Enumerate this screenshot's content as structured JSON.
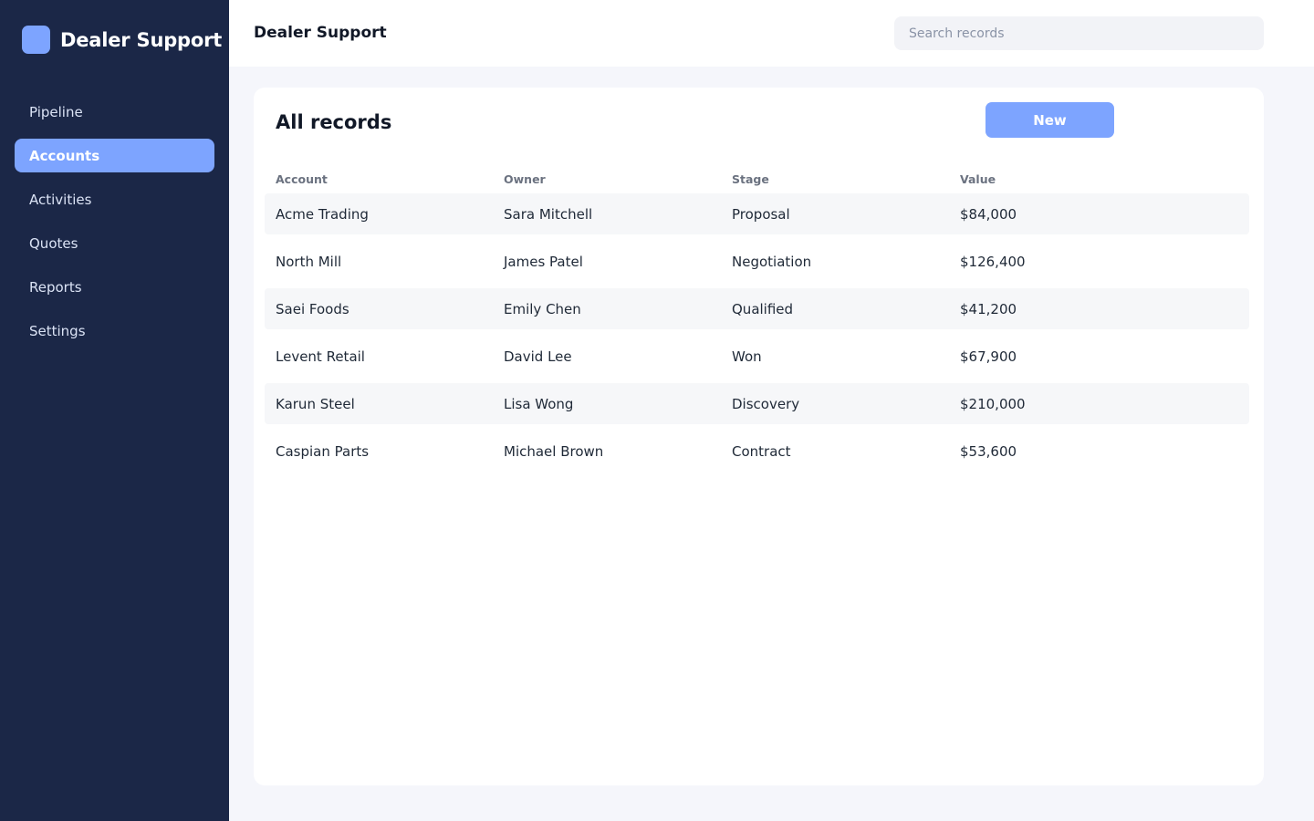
{
  "app": {
    "name": "Dealer Support"
  },
  "sidebar": {
    "items": [
      {
        "label": "Pipeline"
      },
      {
        "label": "Accounts",
        "active": true
      },
      {
        "label": "Activities"
      },
      {
        "label": "Quotes"
      },
      {
        "label": "Reports"
      },
      {
        "label": "Settings"
      }
    ]
  },
  "header": {
    "title": "Dealer Support",
    "search_placeholder": "Search records"
  },
  "main": {
    "title": "All records",
    "new_label": "New",
    "columns": [
      "Account",
      "Owner",
      "Stage",
      "Value"
    ],
    "rows": [
      [
        "Acme Trading",
        "Sara Mitchell",
        "Proposal",
        "$84,000"
      ],
      [
        "North Mill",
        "James Patel",
        "Negotiation",
        "$126,400"
      ],
      [
        "Saei Foods",
        "Emily Chen",
        "Qualified",
        "$41,200"
      ],
      [
        "Levent Retail",
        "David Lee",
        "Won",
        "$67,900"
      ],
      [
        "Karun Steel",
        "Lisa Wong",
        "Discovery",
        "$210,000"
      ],
      [
        "Caspian Parts",
        "Michael Brown",
        "Contract",
        "$53,600"
      ]
    ]
  },
  "colors": {
    "sidebar_bg": "#1b2747",
    "accent": "#7da4ff",
    "page_bg": "#f5f6fb"
  }
}
